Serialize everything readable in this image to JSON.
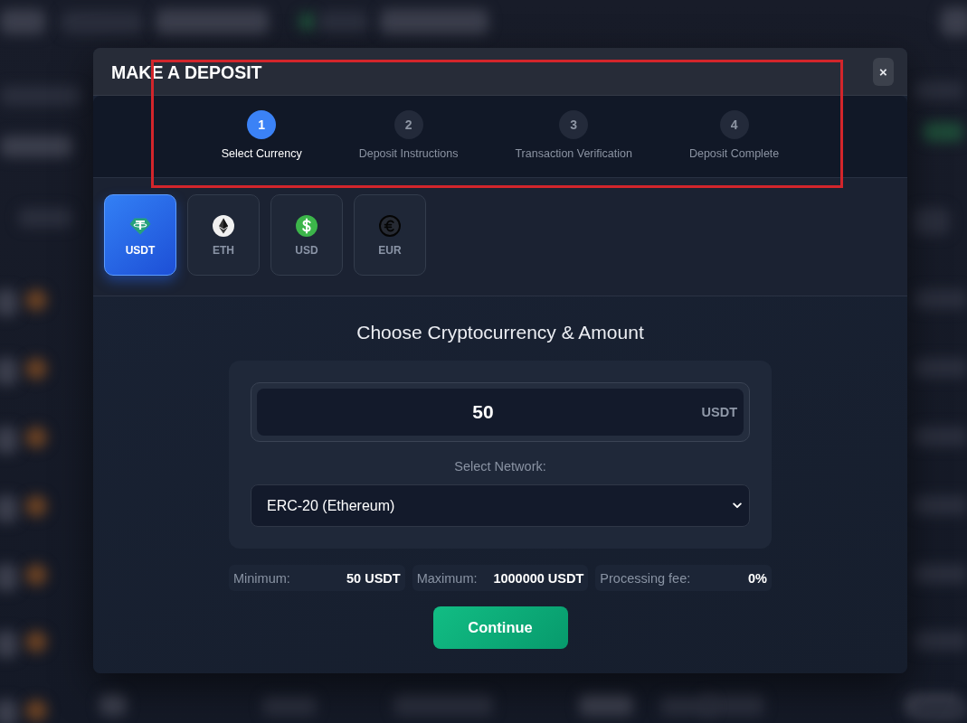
{
  "modal": {
    "title": "MAKE A DEPOSIT",
    "close_label": "×"
  },
  "stepper": {
    "highlighted": true,
    "steps": [
      {
        "number": "1",
        "label": "Select Currency",
        "selected": true
      },
      {
        "number": "2",
        "label": "Deposit Instructions",
        "selected": false
      },
      {
        "number": "3",
        "label": "Transaction Verification",
        "selected": false
      },
      {
        "number": "4",
        "label": "Deposit Complete",
        "selected": false
      }
    ]
  },
  "currencies": [
    {
      "label": "USDT",
      "kind": "tether",
      "selected": true
    },
    {
      "label": "ETH",
      "kind": "ether",
      "selected": false
    },
    {
      "label": "USD",
      "kind": "dollar",
      "selected": false
    },
    {
      "label": "EUR",
      "kind": "euro",
      "selected": false
    }
  ],
  "heading": "Choose Cryptocurrency & Amount",
  "amount": {
    "value": "50",
    "unit": "USDT"
  },
  "network": {
    "label": "Select Network:",
    "value": "ERC-20 (Ethereum)"
  },
  "limits": [
    {
      "label": "Minimum:",
      "value": "50 USDT"
    },
    {
      "label": "Maximum:",
      "value": "1000000 USDT"
    },
    {
      "label": "Processing fee:",
      "value": "0%"
    }
  ],
  "continue_button": "Continue"
}
